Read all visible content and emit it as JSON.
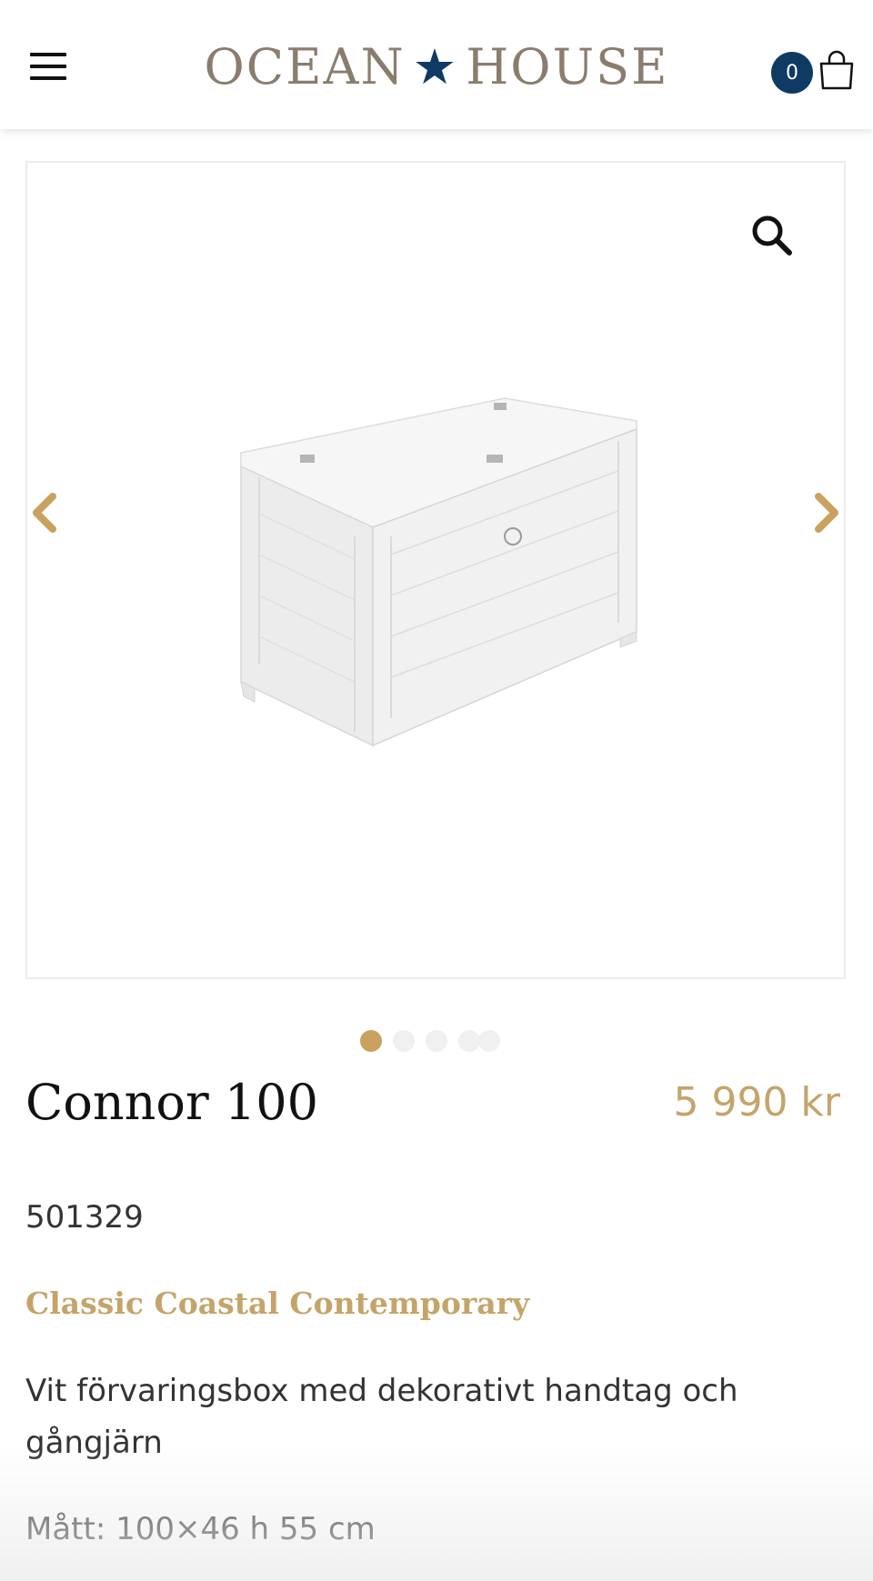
{
  "header": {
    "logo_left": "OCEAN",
    "logo_right": "HOUSE",
    "cart_count": "0"
  },
  "gallery": {
    "image_count": 5,
    "active_index": 0
  },
  "product": {
    "title": "Connor 100",
    "price": "5 990 kr",
    "sku": "501329",
    "collection": "Classic Coastal Contemporary",
    "description": "Vit förvaringsbox med dekorativt handtag och gångjärn",
    "dimensions": "Mått: 100×46 h 55 cm"
  },
  "colors": {
    "accent_gold": "#c5a46a",
    "navy": "#0f3a63",
    "logo_brown": "#8a7d6e"
  }
}
